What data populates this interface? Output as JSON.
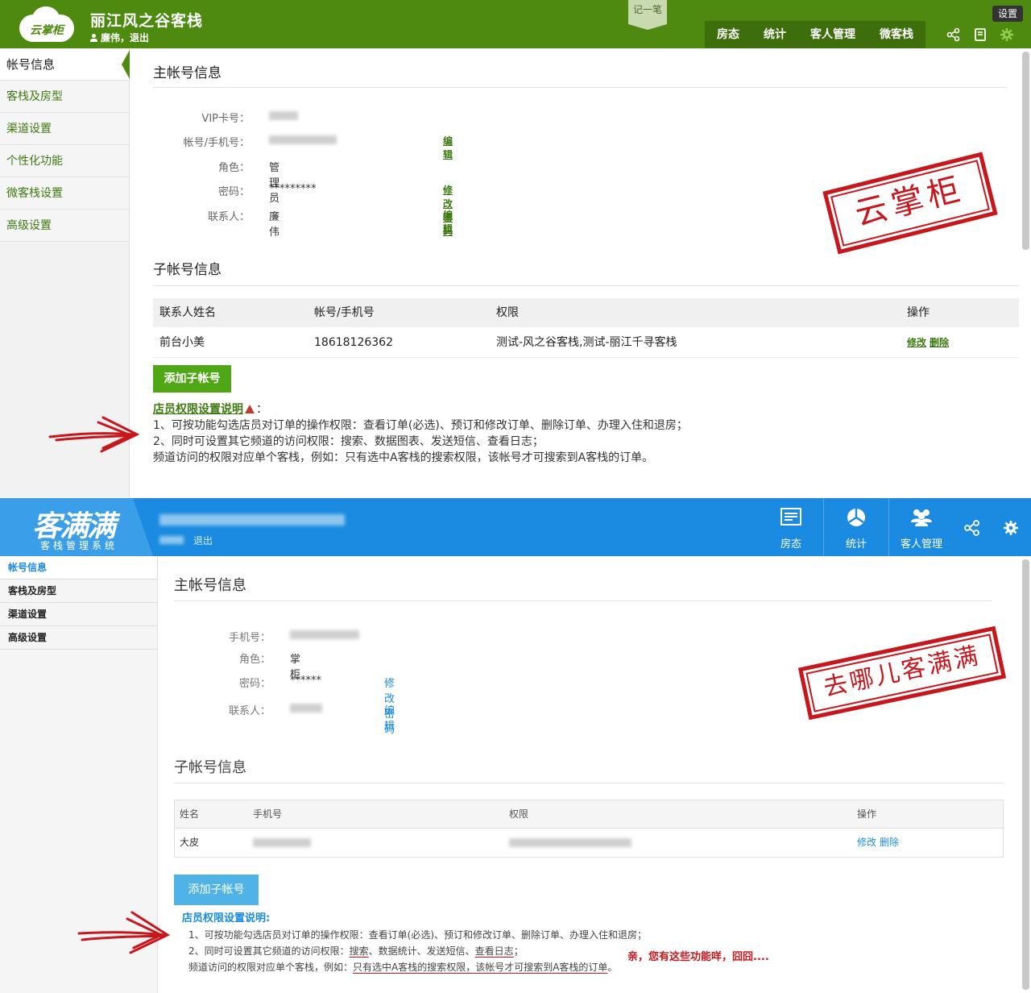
{
  "top": {
    "logo_text": "云掌柜",
    "shop_name": "丽江风之谷客栈",
    "user": "廉伟",
    "logout": "退出",
    "memo": "记一笔",
    "nav": [
      "房态",
      "统计",
      "客人管理",
      "微客栈"
    ],
    "settings_tooltip": "设置",
    "sidebar": [
      "帐号信息",
      "客栈及房型",
      "渠道设置",
      "个性化功能",
      "微客栈设置",
      "高级设置"
    ],
    "main_title": "主帐号信息",
    "fields": {
      "vip_label": "VIP卡号：",
      "account_label": "帐号/手机号：",
      "role_label": "角色：",
      "role_value": "管理员",
      "password_label": "密码：",
      "password_value": "*********",
      "contact_label": "联系人：",
      "contact_value": "廉伟",
      "edit": "编辑",
      "change_password": "修改密码"
    },
    "sub_title": "子帐号信息",
    "table": {
      "headers": [
        "联系人姓名",
        "帐号/手机号",
        "权限",
        "操作"
      ],
      "row": {
        "name": "前台小美",
        "phone": "18618126362",
        "perm": "测试-风之谷客栈,测试-丽江千寻客栈",
        "op_edit": "修改",
        "op_delete": "删除"
      }
    },
    "add_button": "添加子帐号",
    "notes": {
      "title": "店员权限设置说明",
      "colon": "：",
      "line1": "1、可按功能勾选店员对订单的操作权限：查看订单(必选)、预订和修改订单、删除订单、办理入住和退房；",
      "line2": "2、同时可设置其它频道的访问权限：搜索、数据图表、发送短信、查看日志；",
      "line3": "频道访问的权限对应单个客栈，例如：只有选中A客栈的搜索权限，该帐号才可搜索到A客栈的订单。"
    },
    "stamp": "云掌柜"
  },
  "bottom": {
    "logo_text": "客满满",
    "logo_sub": "客栈管理系统",
    "logout": "退出",
    "nav": [
      "房态",
      "统计",
      "客人管理"
    ],
    "sidebar": [
      "帐号信息",
      "客栈及房型",
      "渠道设置",
      "高级设置"
    ],
    "main_title": "主帐号信息",
    "fields": {
      "phone_label": "手机号：",
      "role_label": "角色：",
      "role_value": "掌柜",
      "password_label": "密码：",
      "password_value": "******",
      "contact_label": "联系人：",
      "change_password": "修改密码",
      "edit": "编辑"
    },
    "sub_title": "子帐号信息",
    "table": {
      "headers": [
        "姓名",
        "手机号",
        "权限",
        "操作"
      ],
      "row": {
        "name": "大皮",
        "op_edit": "修改",
        "op_delete": "删除"
      }
    },
    "add_button": "添加子帐号",
    "notes": {
      "title": "店员权限设置说明:",
      "line1": "1、可按功能勾选店员对订单的操作权限：查看订单(必选)、预订和修改订单、删除订单、办理入住和退房；",
      "line2_a": "2、同时可设置其它频道的访问权限：",
      "line2_b": "搜索",
      "line2_c": "、数据统计、发送短信、",
      "line2_d": "查看日志",
      "line2_e": "；",
      "line3_a": "频道访问的权限对应单个客栈，例如：",
      "line3_b": "只有选中A客栈的搜索权限，该帐号才可搜索到A客栈的订单",
      "line3_c": "。"
    },
    "remark": "亲，您有这些功能咩，囧囧....",
    "stamp": "去哪儿客满满"
  }
}
